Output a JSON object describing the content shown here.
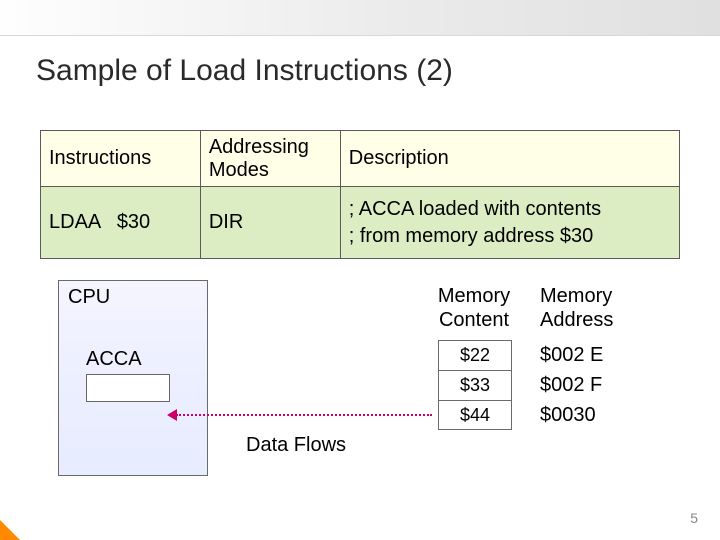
{
  "title": "Sample of Load Instructions (2)",
  "table": {
    "headers": {
      "c0": "Instructions",
      "c1": "Addressing\nModes",
      "c2": "Description"
    },
    "row": {
      "instr": "LDAA   $30",
      "mode": "DIR",
      "desc1": "; ACCA loaded with contents",
      "desc2": "; from memory address $30"
    }
  },
  "cpu": {
    "label": "CPU",
    "acc_label": "ACCA"
  },
  "memory": {
    "header_content": "Memory Content",
    "header_address": "Memory Address",
    "rows": [
      {
        "content": "$22",
        "address": "$002 E"
      },
      {
        "content": "$33",
        "address": "$002 F"
      },
      {
        "content": "$44",
        "address": "$0030"
      }
    ]
  },
  "flow_label": "Data Flows",
  "slide_number": "5"
}
